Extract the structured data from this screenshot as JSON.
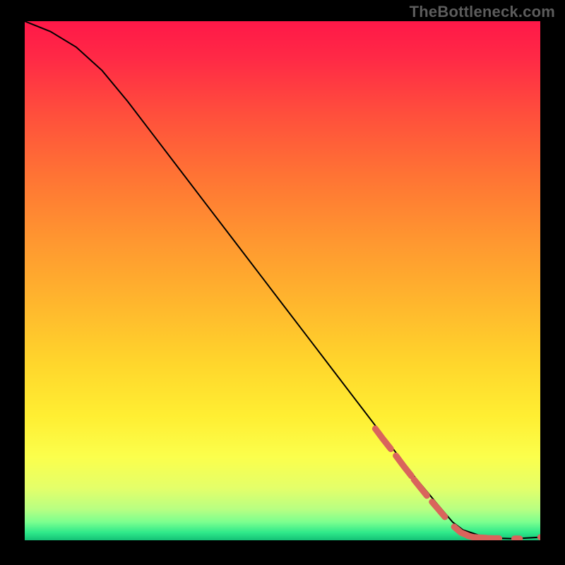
{
  "watermark": "TheBottleneck.com",
  "chart_data": {
    "type": "line",
    "title": "",
    "xlabel": "",
    "ylabel": "",
    "xlim": [
      0,
      100
    ],
    "ylim": [
      0,
      100
    ],
    "curve": {
      "x": [
        0,
        5,
        10,
        15,
        20,
        25,
        30,
        35,
        40,
        45,
        50,
        55,
        60,
        65,
        70,
        75,
        80,
        83,
        85,
        88,
        90,
        92,
        95,
        100
      ],
      "y": [
        100,
        98,
        95,
        90.5,
        84.5,
        78,
        71.5,
        65,
        58.5,
        52,
        45.5,
        39,
        32.5,
        26,
        19.5,
        13,
        7,
        3.5,
        2,
        1,
        0.6,
        0.4,
        0.3,
        0.6
      ]
    },
    "dashed_segments": [
      {
        "x": [
          68,
          69.5,
          71
        ],
        "y": [
          21.5,
          19.5,
          17.6
        ]
      },
      {
        "x": [
          72,
          73.5,
          75
        ],
        "y": [
          16.3,
          14.3,
          12.4
        ]
      },
      {
        "x": [
          75.5,
          76.7,
          78
        ],
        "y": [
          11.7,
          10.2,
          8.6
        ]
      },
      {
        "x": [
          79,
          80.3,
          81.5
        ],
        "y": [
          7.4,
          5.9,
          4.5
        ]
      },
      {
        "x": [
          83.3,
          84.6,
          86
        ],
        "y": [
          2.6,
          1.5,
          0.9
        ]
      },
      {
        "x": [
          86,
          87,
          88.3,
          89.5
        ],
        "y": [
          0.85,
          0.6,
          0.5,
          0.45
        ]
      },
      {
        "x": [
          90,
          91,
          92
        ],
        "y": [
          0.4,
          0.35,
          0.35
        ]
      },
      {
        "x": [
          95,
          96
        ],
        "y": [
          0.3,
          0.3
        ]
      },
      {
        "x": [
          100
        ],
        "y": [
          0.6
        ]
      }
    ],
    "gradient_stops": [
      {
        "offset": 0.0,
        "color": "#ff1848"
      },
      {
        "offset": 0.07,
        "color": "#ff2946"
      },
      {
        "offset": 0.18,
        "color": "#ff4f3c"
      },
      {
        "offset": 0.3,
        "color": "#ff7434"
      },
      {
        "offset": 0.42,
        "color": "#ff9630"
      },
      {
        "offset": 0.55,
        "color": "#ffb82d"
      },
      {
        "offset": 0.66,
        "color": "#ffd62c"
      },
      {
        "offset": 0.76,
        "color": "#ffee32"
      },
      {
        "offset": 0.84,
        "color": "#fbff4c"
      },
      {
        "offset": 0.9,
        "color": "#e4ff6a"
      },
      {
        "offset": 0.94,
        "color": "#b8ff82"
      },
      {
        "offset": 0.965,
        "color": "#7bff8f"
      },
      {
        "offset": 0.985,
        "color": "#2fe98a"
      },
      {
        "offset": 1.0,
        "color": "#14c176"
      }
    ],
    "colors": {
      "curve": "#000000",
      "dash": "#d9645c"
    }
  }
}
